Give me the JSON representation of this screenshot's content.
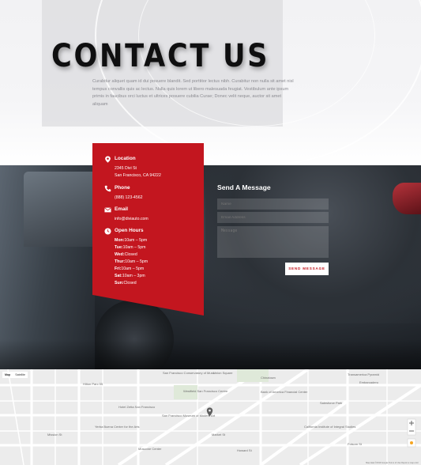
{
  "hero": {
    "title": "CONTACT US",
    "text": "Curabitur aliquet quam id dui posuere blandit. Sed porttitor lectus nibh. Curabitur non nulla sit amet nisl tempus convallis quis ac lectus. Nulla quis lorem ut libero malesuada feugiat. Vestibulum ante ipsum primis in faucibus orci luctus et ultrices posuere cubilia Curae; Donec velit neque, auctor sit amet aliquam"
  },
  "info": {
    "location": {
      "heading": "Location",
      "line1": "2345 Divi St",
      "line2": "San Francisco, CA 94222"
    },
    "phone": {
      "heading": "Phone",
      "value": "(888) 123-4562"
    },
    "email": {
      "heading": "Email",
      "value": "info@diviauto.com"
    },
    "hours": {
      "heading": "Open Hours",
      "days": [
        {
          "day": "Mon:",
          "time": "10am – 5pm"
        },
        {
          "day": "Tue:",
          "time": "10am – 5pm"
        },
        {
          "day": "Wed:",
          "time": "Closed"
        },
        {
          "day": "Thur:",
          "time": "10am – 5pm"
        },
        {
          "day": "Fri:",
          "time": "10am – 5pm"
        },
        {
          "day": "Sat:",
          "time": "10am – 3pm"
        },
        {
          "day": "Sun:",
          "time": "Closed"
        }
      ]
    }
  },
  "form": {
    "title": "Send A Message",
    "name_placeholder": "Name",
    "email_placeholder": "Email Address",
    "message_placeholder": "Message",
    "send_label": "SEND MESSAGE"
  },
  "map": {
    "tabs": [
      "Map",
      "Satellite"
    ],
    "labels": [
      "San Francisco Conservatory of Music",
      "Hotel Zetta San Francisco",
      "Yerba Buena Center for the Arts",
      "Moscone Center",
      "San Francisco Museum of Modern Art",
      "Westfield San Francisco Centre",
      "Bank of America Financial Center",
      "Embarcadero",
      "California Institute of Integral Studies",
      "Hilton Parc 55",
      "Union Square",
      "Salesforce Park",
      "Chinatown",
      "Transamerica Pyramid",
      "Mission St",
      "Market St",
      "Howard St",
      "Folsom St"
    ],
    "footer": "Map data ©2019 Google  Terms of Use  Report a map error"
  },
  "colors": {
    "accent": "#c3161f",
    "dark": "#1b1f24"
  }
}
